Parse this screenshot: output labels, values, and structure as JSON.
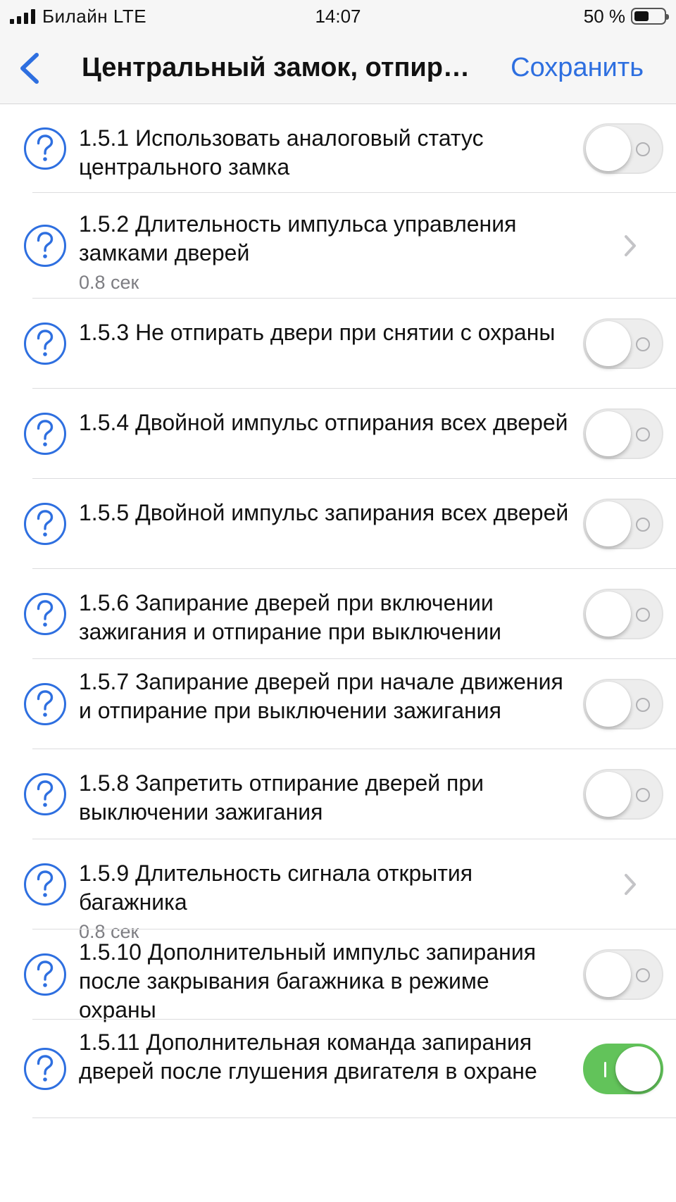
{
  "status_bar": {
    "carrier": "Билайн LTE",
    "time": "14:07",
    "battery_percent": "50 %",
    "battery_level": 0.5
  },
  "nav": {
    "title": "Центральный замок, отпирание и запирание дверей",
    "save_label": "Сохранить",
    "back_icon": "chevron-left-icon"
  },
  "colors": {
    "accent": "#2e6fe0",
    "switch_on": "#62c35a",
    "switch_off": "#ededed"
  },
  "settings": [
    {
      "label": "1.5.1 Использовать аналоговый статус центрального замка",
      "type": "toggle",
      "on": false
    },
    {
      "label": "1.5.2 Длительность импульса управления замками дверей",
      "type": "value",
      "value": "0.8 сек"
    },
    {
      "label": "1.5.3 Не отпирать двери при снятии с охраны",
      "type": "toggle",
      "on": false
    },
    {
      "label": "1.5.4 Двойной импульс отпирания всех дверей",
      "type": "toggle",
      "on": false
    },
    {
      "label": "1.5.5 Двойной импульс запирания всех дверей",
      "type": "toggle",
      "on": false
    },
    {
      "label": "1.5.6 Запирание дверей при включении зажигания и отпирание при выключении",
      "type": "toggle",
      "on": false
    },
    {
      "label": "1.5.7 Запирание дверей при начале движения и отпирание при выключении зажигания",
      "type": "toggle",
      "on": false
    },
    {
      "label": "1.5.8 Запретить отпирание дверей при выключении зажигания",
      "type": "toggle",
      "on": false
    },
    {
      "label": "1.5.9 Длительность сигнала открытия багажника",
      "type": "value",
      "value": "0.8 сек"
    },
    {
      "label": "1.5.10 Дополнительный импульс запирания после закрывания багажника в режиме охраны",
      "type": "toggle",
      "on": false
    },
    {
      "label": "1.5.11 Дополнительная команда запирания дверей после глушения двигателя в охране",
      "type": "toggle",
      "on": true
    }
  ]
}
